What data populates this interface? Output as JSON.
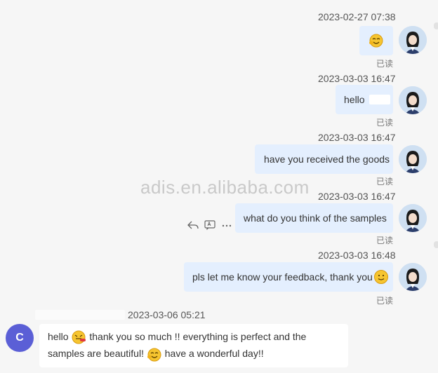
{
  "messages": [
    {
      "timestamp": "2023-02-27 07:38",
      "read_status": "已读"
    },
    {
      "timestamp": "2023-03-03 16:47",
      "text": "hello",
      "read_status": "已读"
    },
    {
      "timestamp": "2023-03-03 16:47",
      "text": "have you received the goods",
      "read_status": "已读"
    },
    {
      "timestamp": "2023-03-03 16:47",
      "text": "what do you think of the samples",
      "read_status": "已读"
    },
    {
      "timestamp": "2023-03-03 16:48",
      "text": "pls let me know your feedback, thank you",
      "read_status": "已读"
    },
    {
      "timestamp": "2023-03-06 05:21",
      "avatar_initial": "C",
      "text_part1": "hello",
      "text_part2": "thank you so much !! everything is perfect and the",
      "text_part3": "samples are beautiful!",
      "text_part4": "have a wonderful day!!"
    }
  ],
  "message_actions": [
    "reply-icon",
    "translate-icon",
    "more-icon"
  ],
  "watermark": "adis.en.alibaba.com",
  "colors": {
    "outgoing_bubble": "#e4effe",
    "incoming_bubble": "#ffffff",
    "background": "#f6f6f6",
    "avatar_initial_bg": "#5b5fd6"
  }
}
